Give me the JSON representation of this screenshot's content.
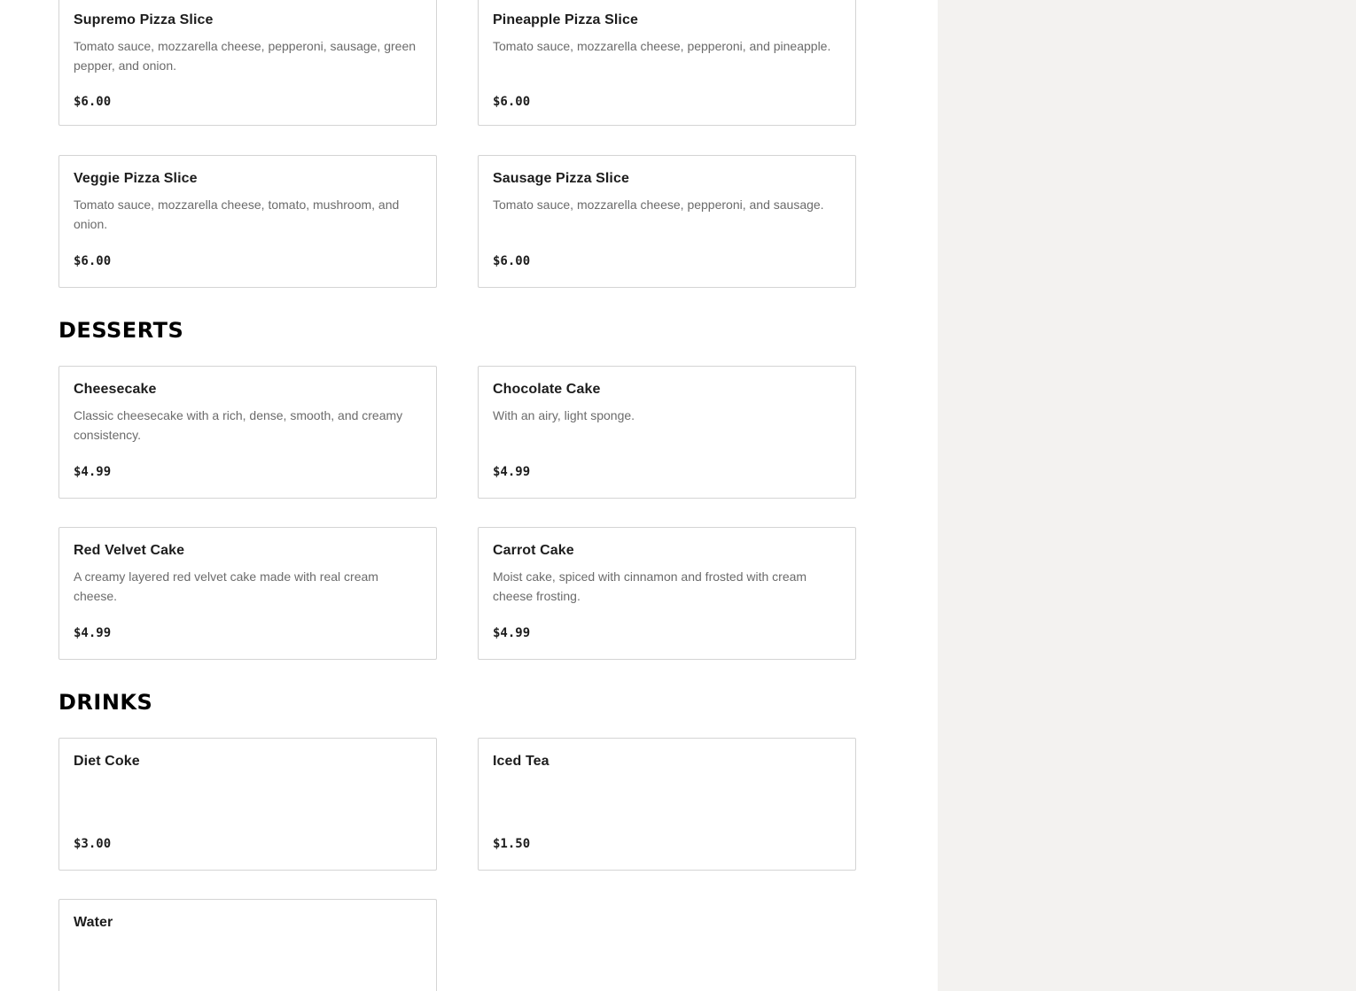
{
  "sections": {
    "pizza": {
      "items": [
        {
          "name": "Supremo Pizza Slice",
          "description": "Tomato sauce, mozzarella cheese, pepperoni, sausage, green pepper, and onion.",
          "price": "$6.00"
        },
        {
          "name": "Pineapple Pizza Slice",
          "description": "Tomato sauce, mozzarella cheese, pepperoni, and pineapple.",
          "price": "$6.00"
        },
        {
          "name": "Veggie Pizza Slice",
          "description": "Tomato sauce, mozzarella cheese, tomato, mushroom, and onion.",
          "price": "$6.00"
        },
        {
          "name": "Sausage Pizza Slice",
          "description": "Tomato sauce, mozzarella cheese, pepperoni, and sausage.",
          "price": "$6.00"
        }
      ]
    },
    "desserts": {
      "title": "DESSERTS",
      "items": [
        {
          "name": "Cheesecake",
          "description": "Classic cheesecake with a rich, dense, smooth, and creamy consistency.",
          "price": "$4.99"
        },
        {
          "name": "Chocolate Cake",
          "description": "With an airy, light sponge.",
          "price": "$4.99"
        },
        {
          "name": "Red Velvet Cake",
          "description": "A creamy layered red velvet cake made with real cream cheese.",
          "price": "$4.99"
        },
        {
          "name": "Carrot Cake",
          "description": "Moist cake, spiced with cinnamon and frosted with cream cheese frosting.",
          "price": "$4.99"
        }
      ]
    },
    "drinks": {
      "title": "DRINKS",
      "items": [
        {
          "name": "Diet Coke",
          "price": "$3.00"
        },
        {
          "name": "Iced Tea",
          "price": "$1.50"
        },
        {
          "name": "Water"
        }
      ]
    }
  }
}
